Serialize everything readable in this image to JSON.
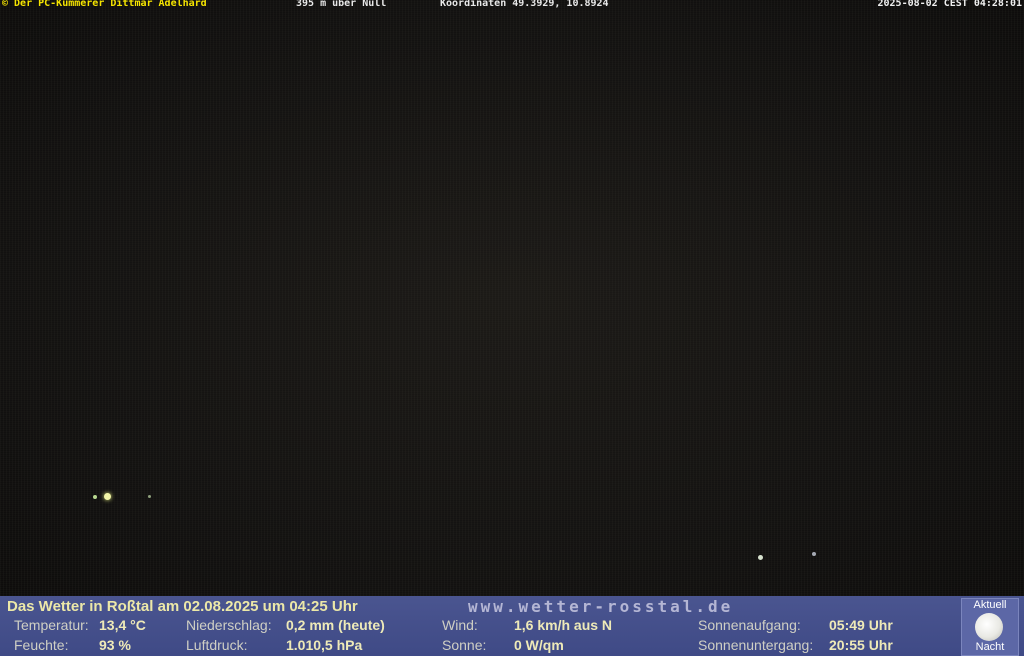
{
  "overlay": {
    "left": "© Der PC-Kümmerer Dittmar Adelhard",
    "altitude": "395 m über Null",
    "coordinates": "Koordinaten 49.3929, 10.8924",
    "timestamp": "2025-08-02 CEST 04:28:01"
  },
  "weather": {
    "title": "Das Wetter in Roßtal am 02.08.2025 um 04:25 Uhr",
    "url": "www.wetter-rosstal.de",
    "temperature_label": "Temperatur:",
    "temperature_value": "13,4 °C",
    "humidity_label": "Feuchte:",
    "humidity_value": "93 %",
    "precip_label": "Niederschlag:",
    "precip_value": "0,2 mm (heute)",
    "pressure_label": "Luftdruck:",
    "pressure_value": "1.010,5 hPa",
    "wind_label": "Wind:",
    "wind_value": "1,6 km/h aus N",
    "sun_label": "Sonne:",
    "sun_value": "0 W/qm",
    "sunrise_label": "Sonnenaufgang:",
    "sunrise_value": "05:49 Uhr",
    "sunset_label": "Sonnenuntergang:",
    "sunset_value": "20:55 Uhr"
  },
  "moon": {
    "top_label": "Aktuell",
    "bottom_label": "Nacht",
    "icon": "full-moon-icon"
  },
  "colors": {
    "overlay_text": "#f5e400",
    "panel_bg": "#4a5590"
  }
}
